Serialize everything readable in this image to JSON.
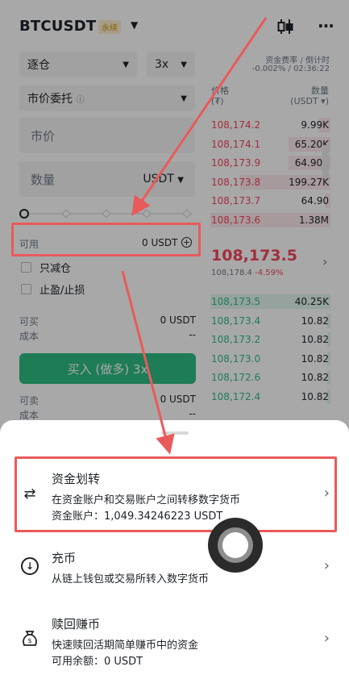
{
  "header": {
    "pair": "BTCUSDT",
    "badge": "永续",
    "candle_icon": "candlestick-icon",
    "more_icon": "more-icon",
    "more_glyph": "···"
  },
  "form": {
    "margin_mode": "逐仓",
    "leverage": "3x",
    "order_type": "市价委托",
    "price_placeholder": "市价",
    "qty_placeholder": "数量",
    "qty_unit": "USDT",
    "available_label": "可用",
    "available_value": "0 USDT",
    "reduce_only": "只减仓",
    "tp_sl": "止盈/止损",
    "can_open_label": "可买",
    "can_open_value": "0 USDT",
    "cost_label": "成本",
    "cost_value": "--",
    "buy_button": "买入 (做多) 3x",
    "can_sell_label": "可卖",
    "can_sell_value": "0 USDT",
    "cost2_label": "成本",
    "cost2_value": "--"
  },
  "funding": {
    "label": "资金费率 / 倒计时",
    "value": "-0.002% / 02:36:22"
  },
  "orderbook": {
    "price_header": "价格",
    "price_unit": "(₮)",
    "qty_header": "数量",
    "qty_unit": "(USDT ▾)",
    "asks": [
      {
        "price": "108,174.2",
        "qty": "9.99K",
        "depth": 0.1
      },
      {
        "price": "108,174.1",
        "qty": "65.20K",
        "depth": 0.35
      },
      {
        "price": "108,173.9",
        "qty": "64.90K",
        "depth": 0.35
      },
      {
        "price": "108,173.8",
        "qty": "199.27K",
        "depth": 0.75
      },
      {
        "price": "108,173.7",
        "qty": "64.90",
        "depth": 0.05
      },
      {
        "price": "108,173.6",
        "qty": "1.38M",
        "depth": 1.0
      }
    ],
    "mid_price": "108,173.5",
    "mark_price": "108,178.4",
    "change": "-4.59%",
    "bids": [
      {
        "price": "108,173.5",
        "qty": "40.25K",
        "depth": 1.0
      },
      {
        "price": "108,173.4",
        "qty": "10.82",
        "depth": 0.03
      },
      {
        "price": "108,173.2",
        "qty": "10.82",
        "depth": 0.03
      },
      {
        "price": "108,173.0",
        "qty": "10.82",
        "depth": 0.03
      },
      {
        "price": "108,172.6",
        "qty": "10.82",
        "depth": 0.03
      },
      {
        "price": "108,172.4",
        "qty": "10.82",
        "depth": 0.03
      }
    ]
  },
  "sheet": {
    "items": [
      {
        "title": "资金划转",
        "desc": "在资金账户和交易账户之间转移数字货币",
        "desc2": "资金账户：1,049.34246223 USDT",
        "icon": "transfer-icon"
      },
      {
        "title": "充币",
        "desc": "从链上钱包或交易所转入数字货币",
        "icon": "deposit-icon"
      },
      {
        "title": "赎回赚币",
        "desc": "快速赎回活期简单赚币中的资金",
        "desc2": "可用余额：0 USDT",
        "icon": "redeem-bag-icon"
      }
    ]
  },
  "colors": {
    "buy": "#2ebd85",
    "sell": "#f6465d",
    "highlight": "#e95a5a"
  }
}
